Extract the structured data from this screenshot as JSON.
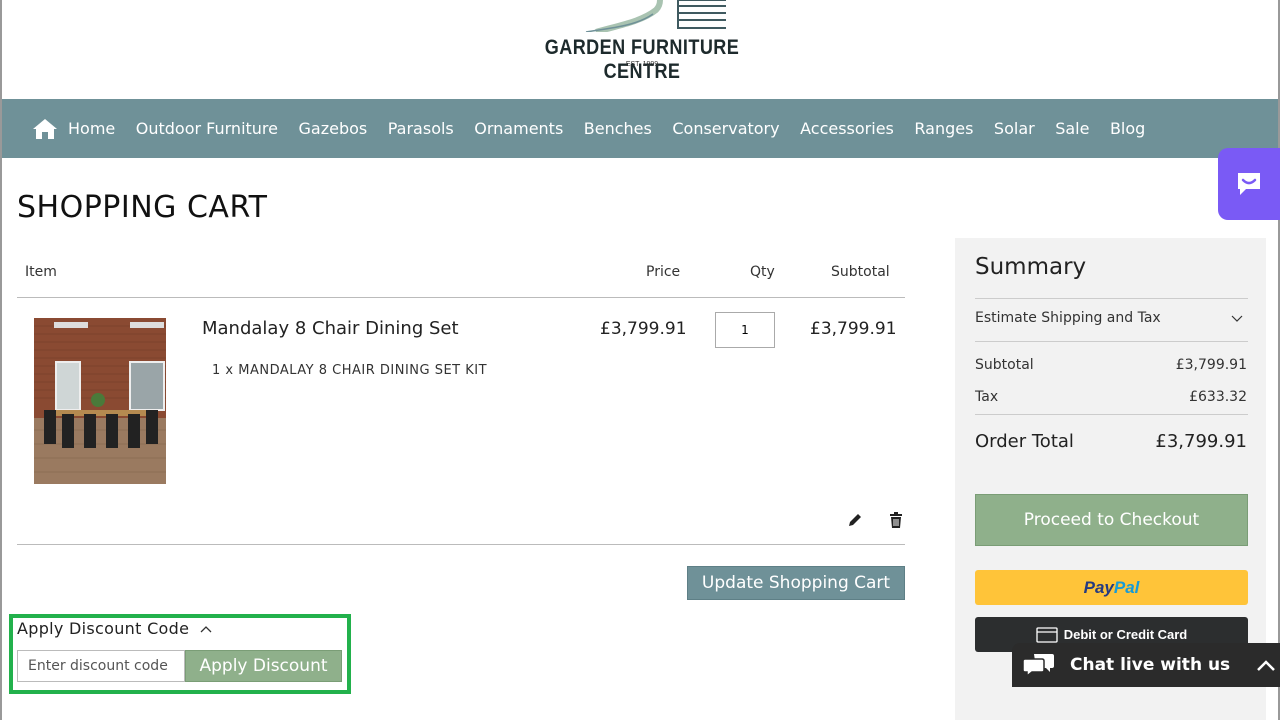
{
  "logo": {
    "name": "GARDEN FURNITURE CENTRE",
    "est": "EST. 1999"
  },
  "nav": {
    "items": [
      {
        "label": "Home"
      },
      {
        "label": "Outdoor Furniture"
      },
      {
        "label": "Gazebos"
      },
      {
        "label": "Parasols"
      },
      {
        "label": "Ornaments"
      },
      {
        "label": "Benches"
      },
      {
        "label": "Conservatory"
      },
      {
        "label": "Accessories"
      },
      {
        "label": "Ranges"
      },
      {
        "label": "Solar"
      },
      {
        "label": "Sale"
      },
      {
        "label": "Blog"
      }
    ]
  },
  "page": {
    "title": "SHOPPING CART"
  },
  "cart": {
    "headers": {
      "item": "Item",
      "price": "Price",
      "qty": "Qty",
      "subtotal": "Subtotal"
    },
    "items": [
      {
        "name": "Mandalay 8 Chair Dining Set",
        "option": "1 x MANDALAY 8 CHAIR DINING SET KIT",
        "price": "£3,799.91",
        "qty": "1",
        "subtotal": "£3,799.91"
      }
    ],
    "update_label": "Update Shopping Cart"
  },
  "discount": {
    "title": "Apply Discount Code",
    "placeholder": "Enter discount code",
    "button_label": "Apply Discount"
  },
  "summary": {
    "title": "Summary",
    "shipping_label": "Estimate Shipping and Tax",
    "subtotal_label": "Subtotal",
    "subtotal_value": "£3,799.91",
    "tax_label": "Tax",
    "tax_value": "£633.32",
    "total_label": "Order Total",
    "total_value": "£3,799.91",
    "checkout_label": "Proceed to Checkout",
    "paypal_a": "Pay",
    "paypal_b": "Pal",
    "card_label": "Debit or Credit Card"
  },
  "chat": {
    "label": "Chat live with us"
  },
  "colors": {
    "nav_bg": "#6f9198",
    "green_button": "#8fb08b",
    "highlight": "#22b14c",
    "chat_widget": "#7a5af5",
    "paypal": "#ffc439"
  }
}
